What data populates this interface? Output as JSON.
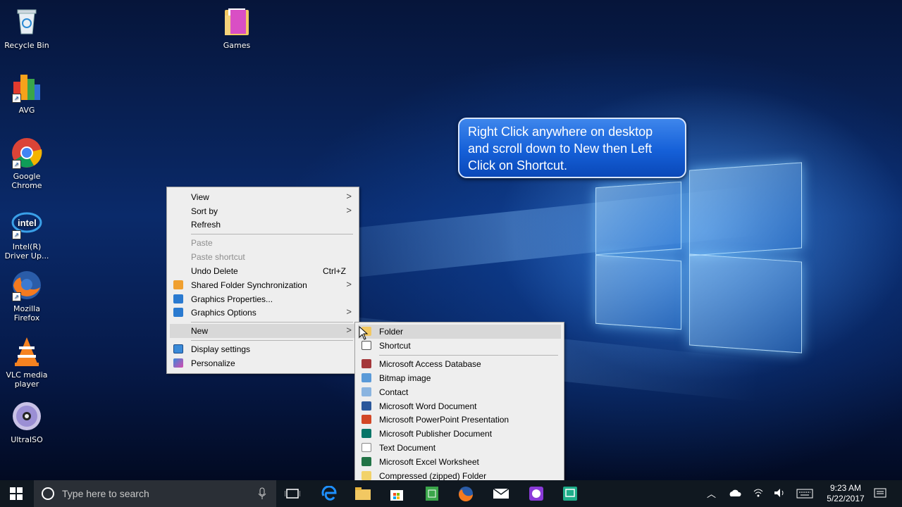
{
  "desktop": {
    "icons": [
      {
        "label": "Recycle Bin",
        "icon": "recycle-bin-icon"
      },
      {
        "label": "Games",
        "icon": "folder-icon"
      },
      {
        "label": "AVG",
        "icon": "avg-icon"
      },
      {
        "label": "Google Chrome",
        "icon": "chrome-icon"
      },
      {
        "label": "Intel(R) Driver Up...",
        "icon": "intel-icon"
      },
      {
        "label": "Mozilla Firefox",
        "icon": "firefox-icon"
      },
      {
        "label": "VLC media player",
        "icon": "vlc-icon"
      },
      {
        "label": "UltraISO",
        "icon": "ultraiso-icon"
      }
    ]
  },
  "callout": {
    "text": "Right Click anywhere on desktop and scroll down to New then Left Click on Shortcut."
  },
  "context_menu": {
    "items": [
      {
        "label": "View",
        "submenu": true
      },
      {
        "label": "Sort by",
        "submenu": true
      },
      {
        "label": "Refresh"
      },
      {
        "label": "Paste",
        "disabled": true
      },
      {
        "label": "Paste shortcut",
        "disabled": true
      },
      {
        "label": "Undo Delete",
        "shortcut": "Ctrl+Z"
      },
      {
        "label": "Shared Folder Synchronization",
        "submenu": true,
        "icon": "sync-icon"
      },
      {
        "label": "Graphics Properties...",
        "icon": "graphics-icon"
      },
      {
        "label": "Graphics Options",
        "submenu": true,
        "icon": "graphics-icon"
      },
      {
        "label": "New",
        "submenu": true,
        "highlighted": true
      },
      {
        "label": "Display settings",
        "icon": "display-icon"
      },
      {
        "label": "Personalize",
        "icon": "personalize-icon"
      }
    ]
  },
  "new_submenu": {
    "items": [
      {
        "label": "Folder",
        "icon": "folder-icon",
        "highlighted": true
      },
      {
        "label": "Shortcut",
        "icon": "shortcut-icon"
      },
      {
        "label": "Microsoft Access Database",
        "icon": "access-icon"
      },
      {
        "label": "Bitmap image",
        "icon": "bitmap-icon"
      },
      {
        "label": "Contact",
        "icon": "contact-icon"
      },
      {
        "label": "Microsoft Word Document",
        "icon": "word-icon"
      },
      {
        "label": "Microsoft PowerPoint Presentation",
        "icon": "powerpoint-icon"
      },
      {
        "label": "Microsoft Publisher Document",
        "icon": "publisher-icon"
      },
      {
        "label": "Text Document",
        "icon": "text-document-icon"
      },
      {
        "label": "Microsoft Excel Worksheet",
        "icon": "excel-icon"
      },
      {
        "label": "Compressed (zipped) Folder",
        "icon": "zip-folder-icon"
      }
    ]
  },
  "taskbar": {
    "search_placeholder": "Type here to search",
    "time": "9:23 AM",
    "date": "5/22/2017"
  }
}
